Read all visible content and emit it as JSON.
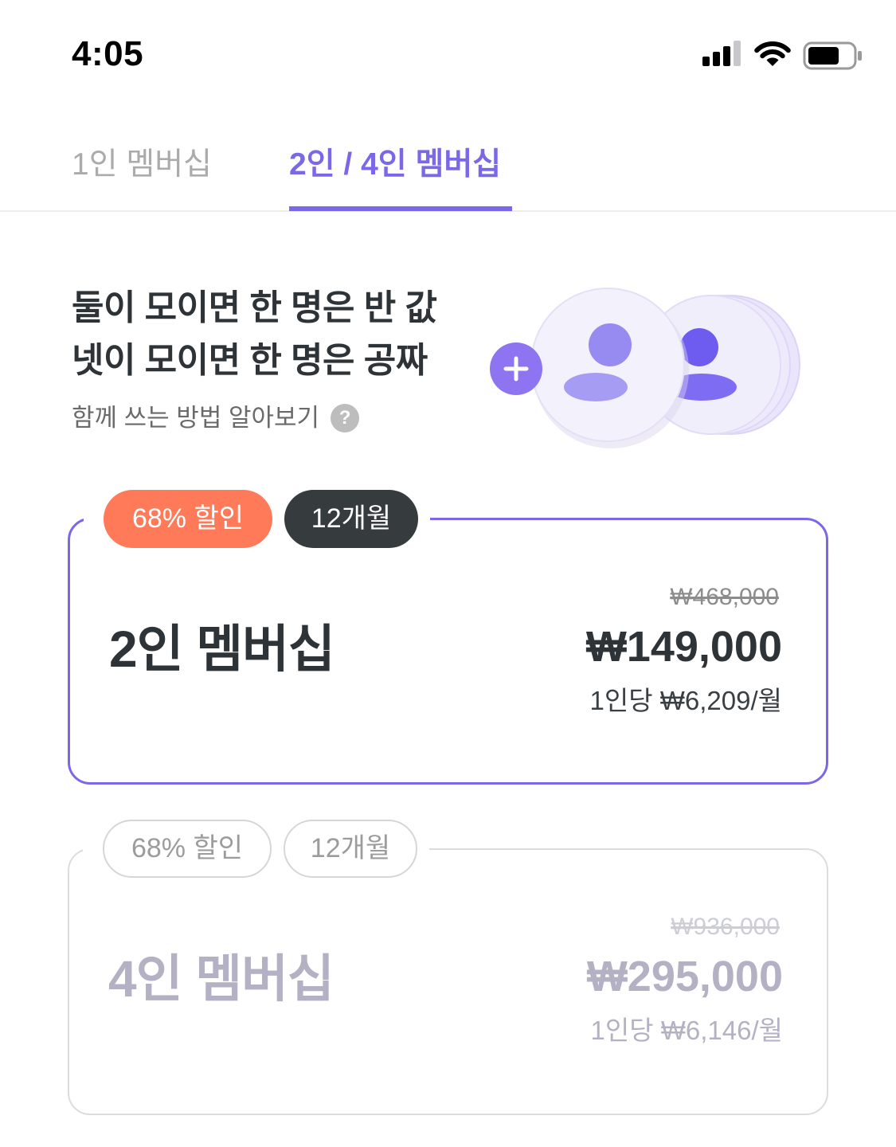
{
  "status_bar": {
    "time": "4:05",
    "icons": [
      "signal-icon",
      "wifi-icon",
      "battery-icon"
    ]
  },
  "tabs": [
    {
      "label": "1인 멤버십",
      "active": false
    },
    {
      "label": "2인 / 4인 멤버십",
      "active": true
    }
  ],
  "hero": {
    "line1": "둘이 모이면 한 명은 반 값",
    "line2": "넷이 모이면 한 명은 공짜",
    "help_link": "함께 쓰는 방법 알아보기",
    "help_icon_glyph": "?",
    "illustration_icons": [
      "plus-icon",
      "person-icon"
    ]
  },
  "plans": [
    {
      "name": "2인 멤버십",
      "selected": true,
      "discount_badge": "68% 할인",
      "period_badge": "12개월",
      "original_price": "₩468,000",
      "price": "₩149,000",
      "per_person": "1인당 ₩6,209/월"
    },
    {
      "name": "4인 멤버십",
      "selected": false,
      "discount_badge": "68% 할인",
      "period_badge": "12개월",
      "original_price": "₩936,000",
      "price": "₩295,000",
      "per_person": "1인당 ₩6,146/월"
    }
  ],
  "colors": {
    "accent": "#7B68E8",
    "discount": "#FF7A59",
    "period": "#363B3E",
    "text": "#2E3337",
    "muted": "#B3B1C3",
    "help": "#BDBDBD"
  }
}
